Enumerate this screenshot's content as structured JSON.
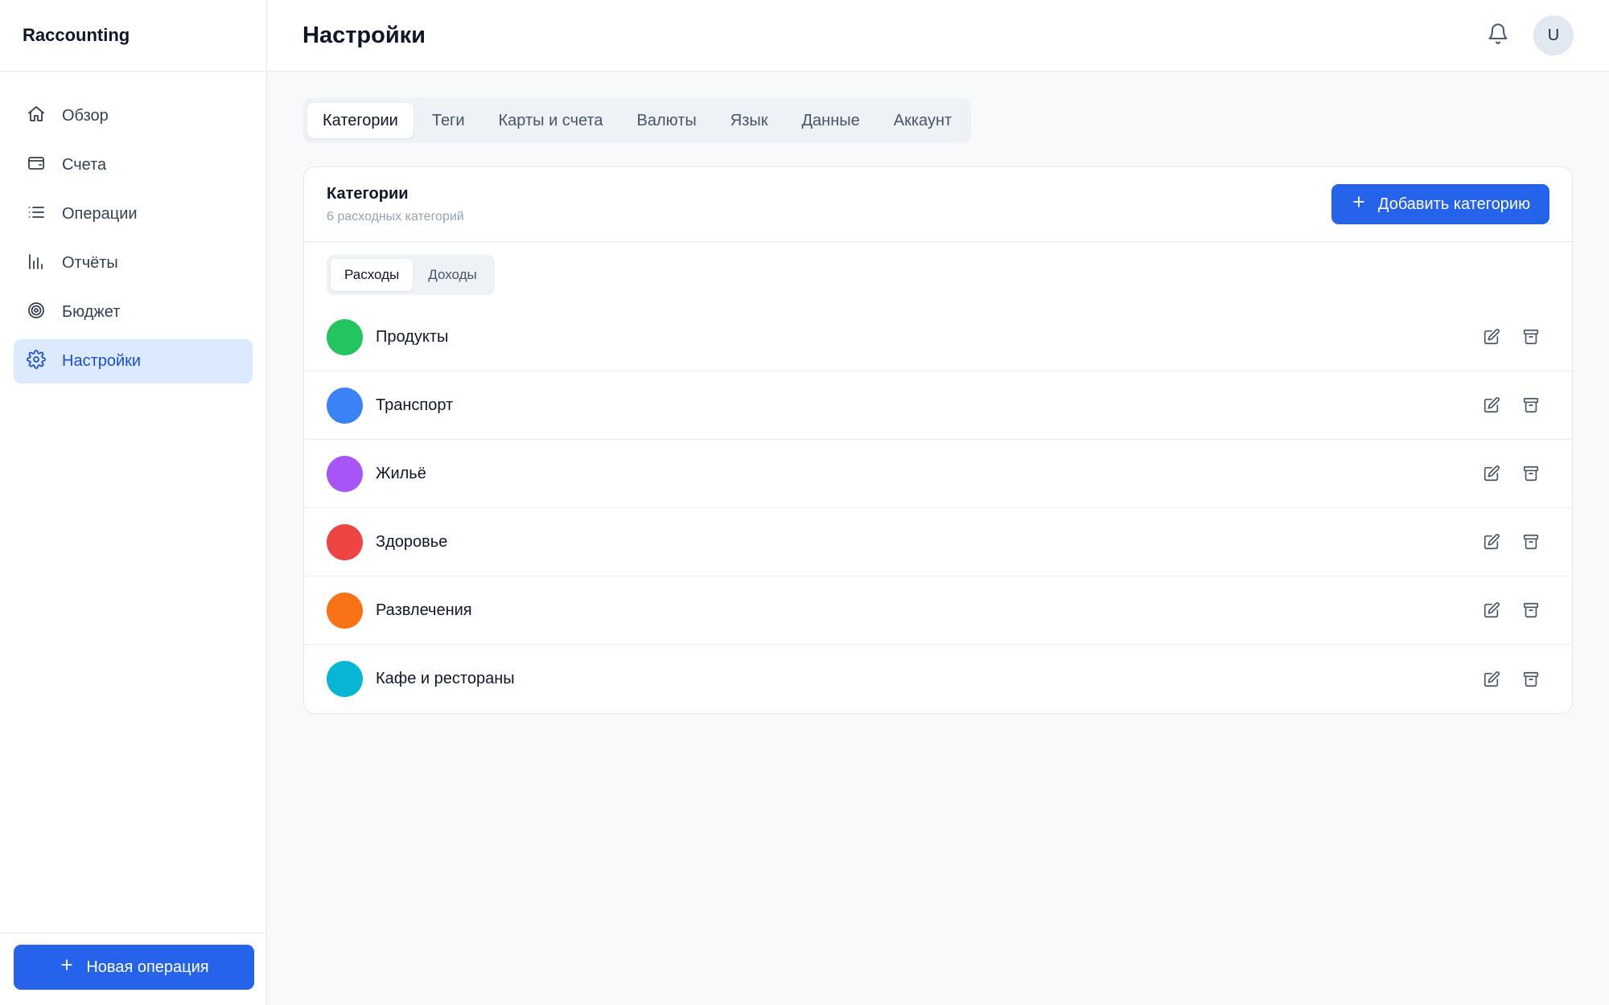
{
  "app": {
    "name": "Raccounting"
  },
  "sidebar": {
    "items": [
      {
        "label": "Обзор",
        "icon": "home-icon"
      },
      {
        "label": "Счета",
        "icon": "wallet-icon"
      },
      {
        "label": "Операции",
        "icon": "list-icon"
      },
      {
        "label": "Отчёты",
        "icon": "bar-chart-icon"
      },
      {
        "label": "Бюджет",
        "icon": "target-icon"
      },
      {
        "label": "Настройки",
        "icon": "gear-icon",
        "active": true
      }
    ],
    "new_operation_label": "Новая операция"
  },
  "header": {
    "title": "Настройки",
    "avatar_initial": "U"
  },
  "tabs": [
    "Категории",
    "Теги",
    "Карты и счета",
    "Валюты",
    "Язык",
    "Данные",
    "Аккаунт"
  ],
  "active_tab": "Категории",
  "card": {
    "title": "Категории",
    "subtitle": "6 расходных категорий",
    "add_label": "Добавить категорию",
    "segments": [
      "Расходы",
      "Доходы"
    ],
    "active_segment": "Расходы",
    "categories": [
      {
        "name": "Продукты",
        "color": "#22c55e"
      },
      {
        "name": "Транспорт",
        "color": "#3b82f6"
      },
      {
        "name": "Жильё",
        "color": "#a855f7"
      },
      {
        "name": "Здоровье",
        "color": "#ef4444"
      },
      {
        "name": "Развлечения",
        "color": "#f97316"
      },
      {
        "name": "Кафе и рестораны",
        "color": "#06b6d4"
      }
    ]
  },
  "colors": {
    "accent": "#2563eb",
    "active_bg": "#dbeafe",
    "active_text": "#1d4ed8"
  }
}
